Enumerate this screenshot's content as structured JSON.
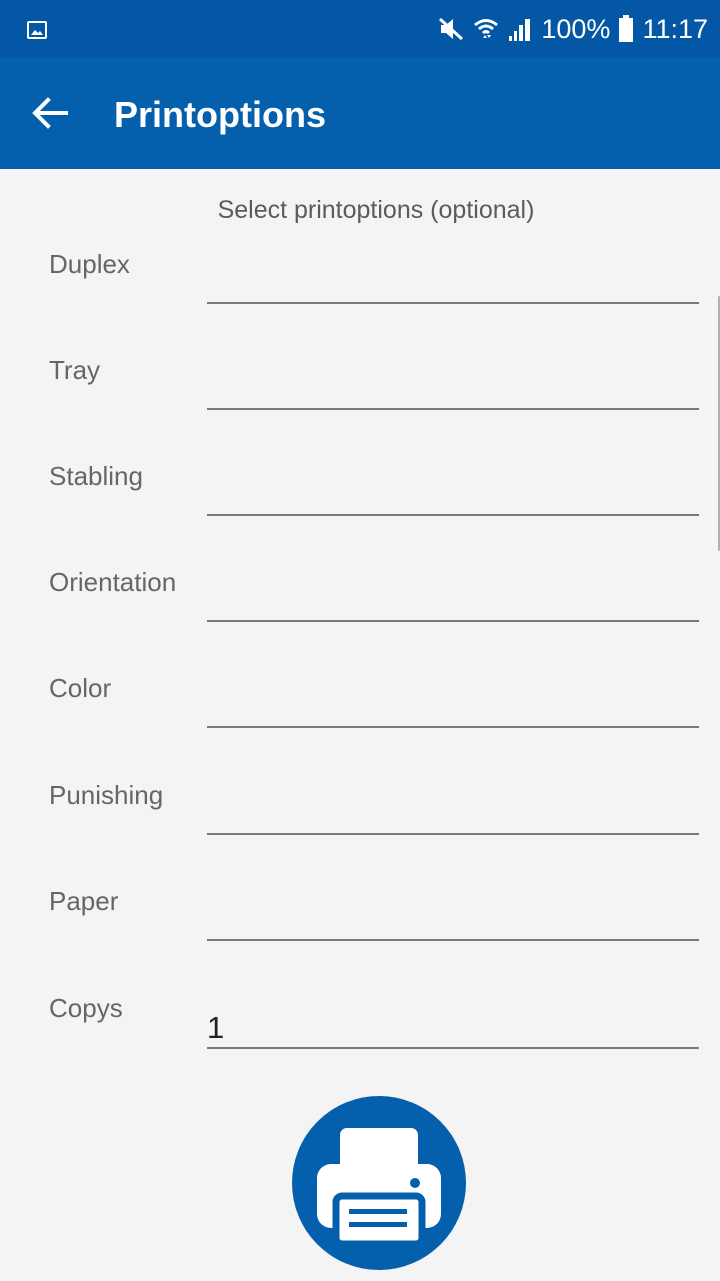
{
  "status_bar": {
    "battery": "100%",
    "time": "11:17",
    "icons": [
      "gallery-notification-icon",
      "mute-icon",
      "wifi-icon",
      "signal-icon",
      "battery-icon"
    ]
  },
  "app_bar": {
    "title": "Printoptions",
    "back_icon": "arrow-left-icon"
  },
  "form": {
    "subtitle": "Select printoptions (optional)",
    "options": [
      {
        "label": "Duplex",
        "value": ""
      },
      {
        "label": "Tray",
        "value": ""
      },
      {
        "label": "Stabling",
        "value": ""
      },
      {
        "label": "Orientation",
        "value": ""
      },
      {
        "label": "Color",
        "value": ""
      },
      {
        "label": "Punishing",
        "value": ""
      },
      {
        "label": "Paper",
        "value": ""
      }
    ],
    "copies": {
      "label": "Copys",
      "value": "1"
    }
  },
  "print_button": {
    "icon": "printer-icon"
  },
  "colors": {
    "status_bar": "#0457a4",
    "app_bar": "#0460ad",
    "background": "#f4f4f4",
    "accent": "#0460ad"
  }
}
